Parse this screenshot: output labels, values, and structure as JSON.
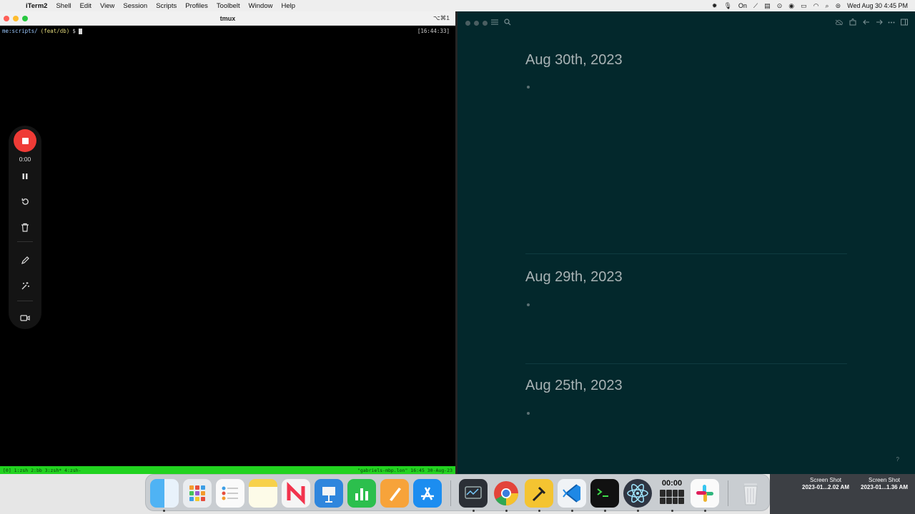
{
  "menubar": {
    "app_name": "iTerm2",
    "items": [
      "Shell",
      "Edit",
      "View",
      "Session",
      "Scripts",
      "Profiles",
      "Toolbelt",
      "Window",
      "Help"
    ],
    "status_on": "On",
    "datetime": "Wed Aug 30  4:45 PM"
  },
  "tmux": {
    "title": "tmux",
    "shortcut": "⌥⌘1",
    "prompt_host": "me:scripts/",
    "prompt_branch": "(feat/db)",
    "prompt_symbol": "$",
    "clock": "[16:44:33]",
    "status_left": "[0] 1:zsh  2:bb  3:zsh* 4:zsh-",
    "status_right": "\"gabriels-mbp.lon\" 16:45 30-Aug-23"
  },
  "recorder": {
    "timer": "0:00"
  },
  "journal": {
    "days": [
      {
        "title": "Aug 30th, 2023"
      },
      {
        "title": "Aug 29th, 2023"
      },
      {
        "title": "Aug 25th, 2023"
      }
    ],
    "help": "?"
  },
  "dock": {
    "stopwatch_time": "00:00",
    "apps": [
      "finder-icon",
      "launchpad-icon",
      "reminders-icon",
      "notes-icon",
      "news-icon",
      "keynote-icon",
      "numbers-icon",
      "pages-icon",
      "app-store-icon",
      "system-monitor-icon",
      "chrome-icon",
      "build-tool-icon",
      "vscode-icon",
      "terminal-icon",
      "electron-icon",
      "stopwatch-icon",
      "slack-icon",
      "trash-icon"
    ]
  },
  "desktop_files": [
    {
      "name": "Screen Shot",
      "detail": "2023-01...2.02 AM"
    },
    {
      "name": "Screen Shot",
      "detail": "2023-01...1.36 AM"
    }
  ]
}
